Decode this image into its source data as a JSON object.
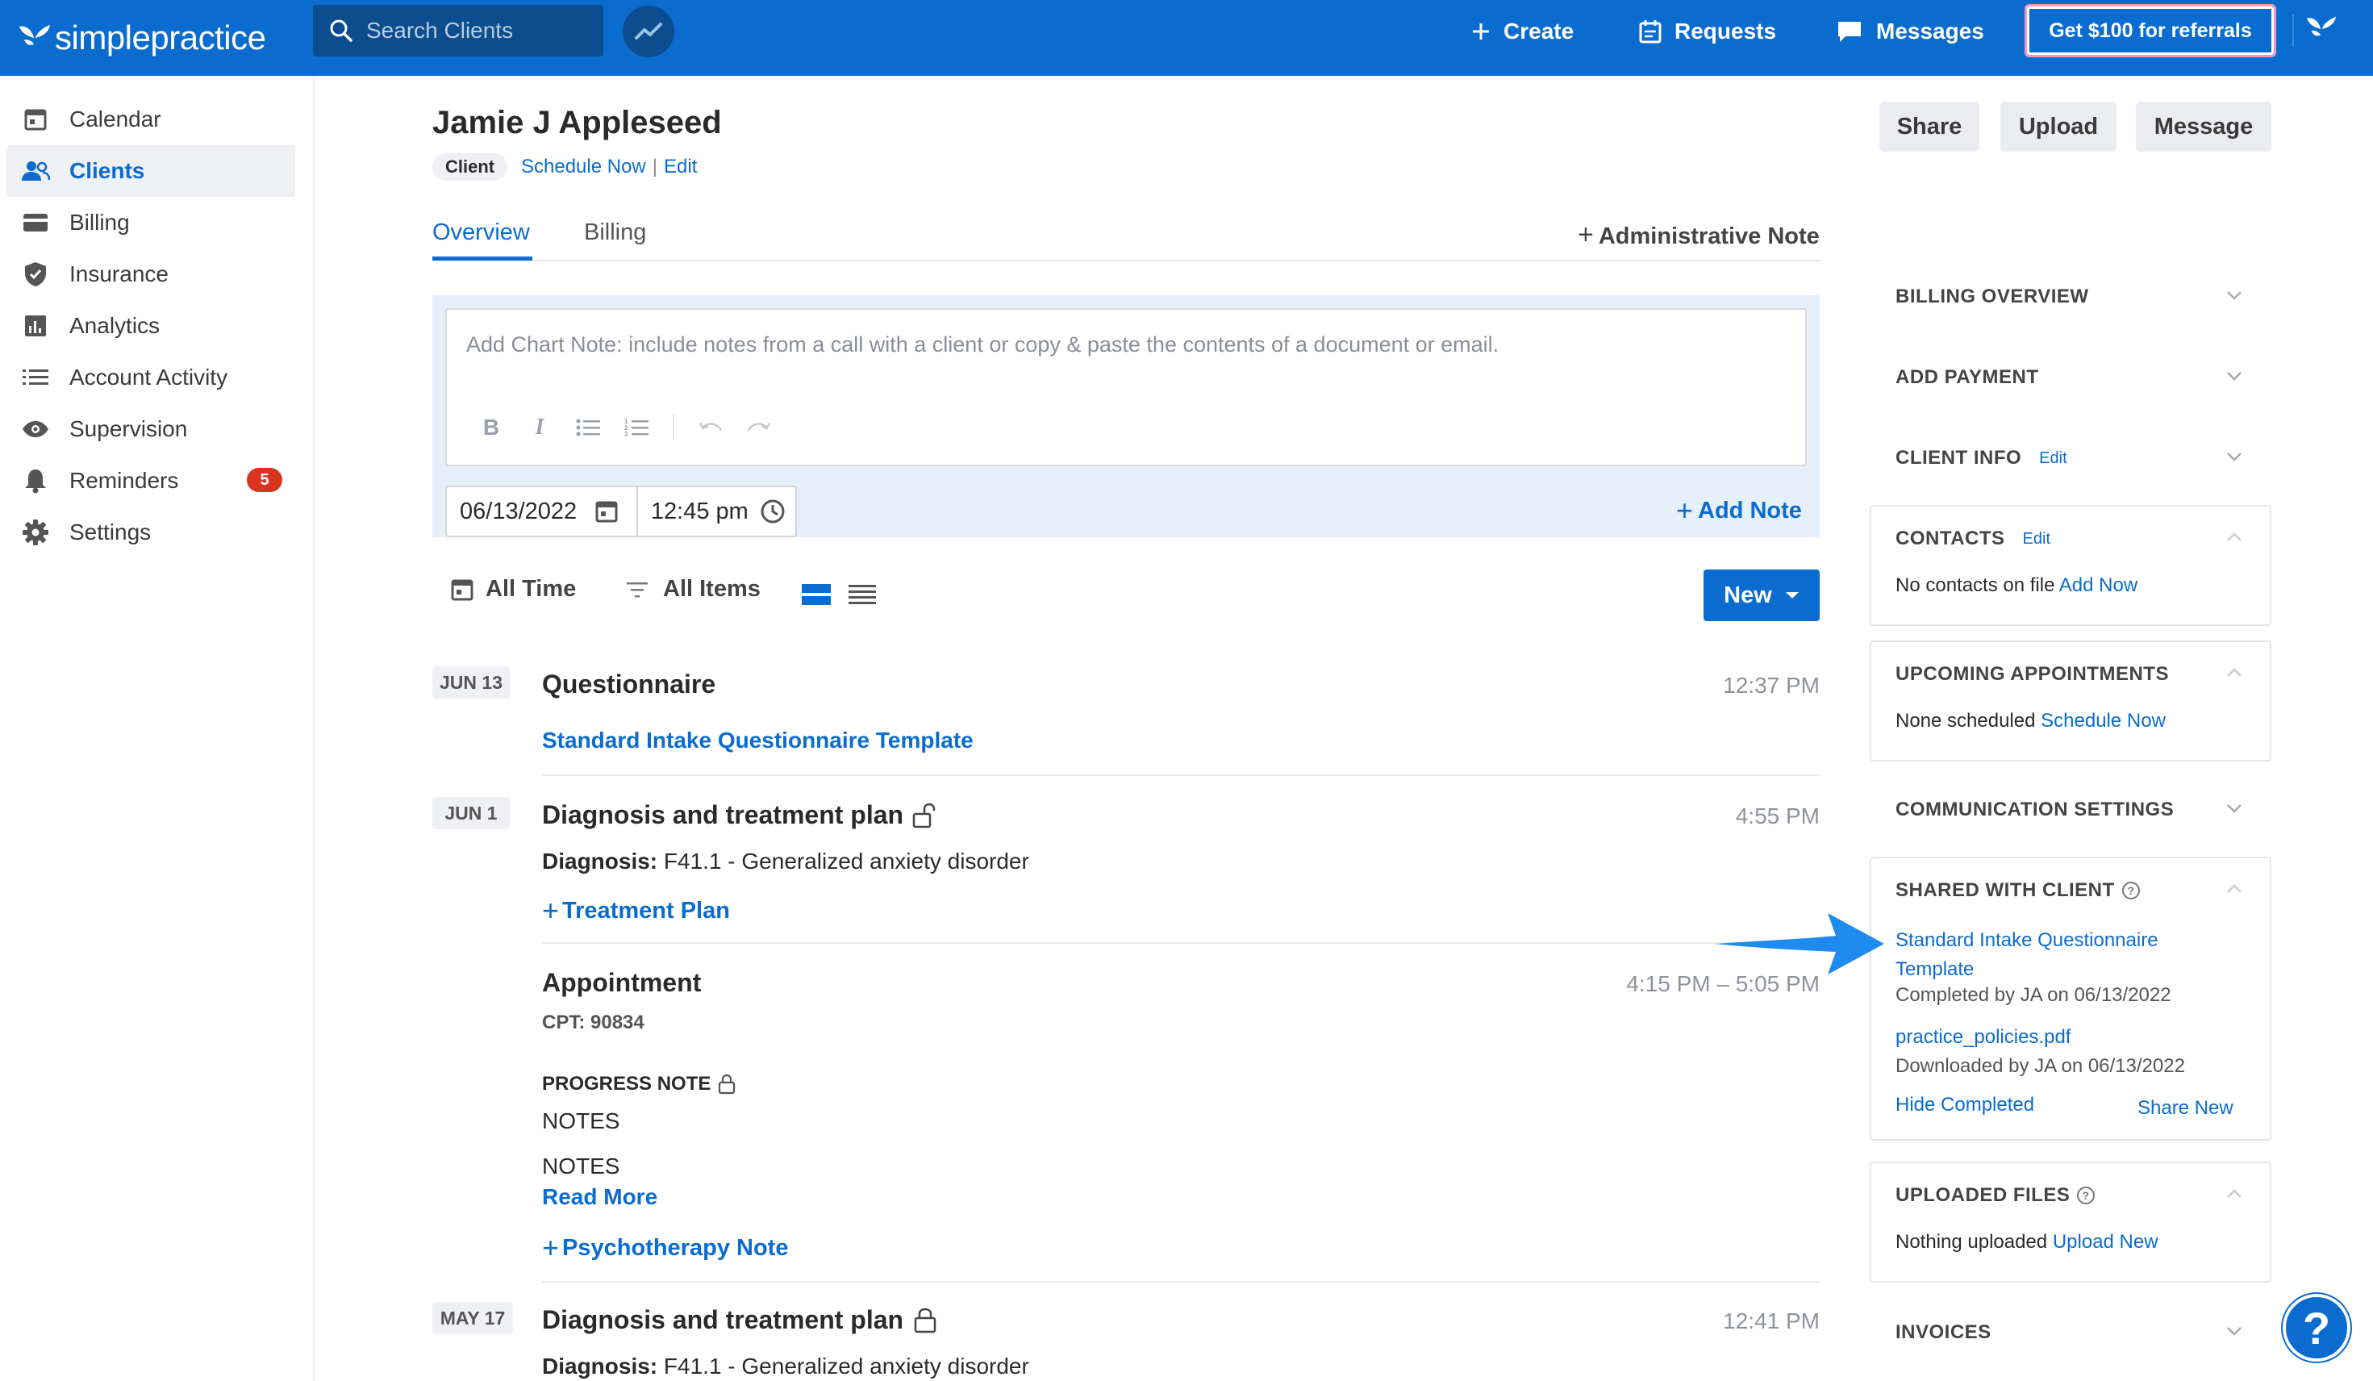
{
  "app": {
    "brand": "simplepractice"
  },
  "topbar": {
    "search_placeholder": "Search Clients",
    "create": "Create",
    "requests": "Requests",
    "messages": "Messages",
    "referral": "Get $100 for referrals"
  },
  "sidebar": {
    "items": [
      {
        "label": "Calendar",
        "icon": "calendar-icon"
      },
      {
        "label": "Clients",
        "icon": "people-icon"
      },
      {
        "label": "Billing",
        "icon": "credit-card-icon"
      },
      {
        "label": "Insurance",
        "icon": "shield-icon"
      },
      {
        "label": "Analytics",
        "icon": "bar-chart-icon"
      },
      {
        "label": "Account Activity",
        "icon": "list-icon"
      },
      {
        "label": "Supervision",
        "icon": "eye-icon"
      },
      {
        "label": "Reminders",
        "icon": "bell-icon",
        "badge": "5"
      },
      {
        "label": "Settings",
        "icon": "gear-icon"
      }
    ]
  },
  "client": {
    "name": "Jamie J Appleseed",
    "tag": "Client",
    "schedule_now": "Schedule Now",
    "separator": "|",
    "edit": "Edit"
  },
  "header_buttons": {
    "share": "Share",
    "upload": "Upload",
    "message": "Message"
  },
  "tabs": {
    "overview": "Overview",
    "billing": "Billing",
    "admin_note": "Administrative Note"
  },
  "chart_note": {
    "placeholder": "Add Chart Note: include notes from a call with a client or copy & paste the contents of a document or email.",
    "date": "06/13/2022",
    "time": "12:45 pm",
    "add_note": "Add Note"
  },
  "filters": {
    "time": "All Time",
    "items": "All Items",
    "new": "New"
  },
  "timeline": [
    {
      "date": "JUN 13",
      "title": "Questionnaire",
      "time": "12:37 PM",
      "link": "Standard Intake Questionnaire Template"
    },
    {
      "date": "JUN 1",
      "title": "Diagnosis and treatment plan",
      "time": "4:55 PM",
      "diagnosis_label": "Diagnosis:",
      "diagnosis_value": "F41.1 - Generalized anxiety disorder",
      "add_link": "Treatment Plan"
    },
    {
      "title": "Appointment",
      "time": "4:15 PM – 5:05 PM",
      "cpt": "CPT: 90834",
      "progress_label": "PROGRESS NOTE",
      "notes1": "NOTES",
      "notes2": "NOTES",
      "read_more": "Read More",
      "add_link": "Psychotherapy Note"
    },
    {
      "date": "MAY 17",
      "title": "Diagnosis and treatment plan",
      "time": "12:41 PM",
      "diagnosis_label": "Diagnosis:",
      "diagnosis_value": "F41.1 - Generalized anxiety disorder"
    }
  ],
  "right_panel": {
    "billing_overview": "BILLING OVERVIEW",
    "add_payment": "ADD PAYMENT",
    "client_info": "CLIENT INFO",
    "contacts": "CONTACTS",
    "edit": "Edit",
    "contacts_text": "No contacts on file",
    "contacts_link": "Add Now",
    "upcoming": "UPCOMING APPOINTMENTS",
    "upcoming_text": "None scheduled",
    "upcoming_link": "Schedule Now",
    "communication": "COMMUNICATION SETTINGS",
    "shared": "SHARED WITH CLIENT",
    "shared_item1_line1": "Standard Intake Questionnaire",
    "shared_item1_line2": "Template",
    "shared_item1_status": "Completed by JA on 06/13/2022",
    "shared_item2": "practice_policies.pdf",
    "shared_item2_status": "Downloaded by JA on 06/13/2022",
    "hide_completed": "Hide Completed",
    "share_new": "Share New",
    "uploaded": "UPLOADED FILES",
    "uploaded_text": "Nothing uploaded",
    "uploaded_link": "Upload New",
    "invoices": "INVOICES"
  },
  "help": {
    "label": "?"
  },
  "colors": {
    "brand": "#0a6ccf",
    "badge": "#d9341f",
    "arrow": "#1e8bf0",
    "note_panel": "#e6f0fb"
  }
}
